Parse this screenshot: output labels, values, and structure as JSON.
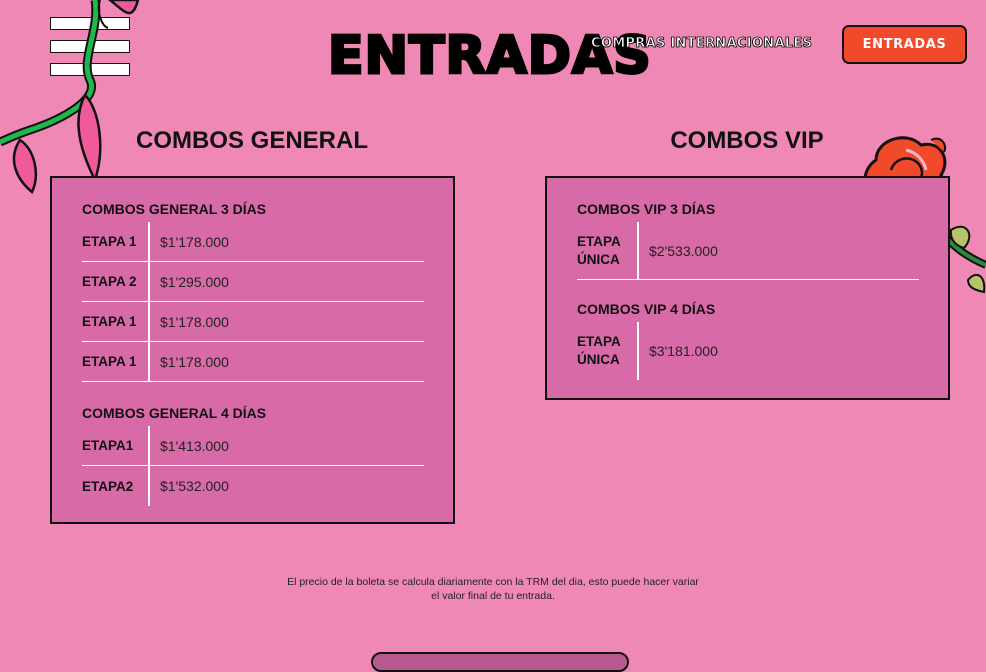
{
  "header": {
    "title": "ENTRADAS",
    "international_link": "COMPRAS INTERNACIONALES",
    "cta_button": "ENTRADAS"
  },
  "general": {
    "title": "COMBOS GENERAL",
    "groups": [
      {
        "label": "COMBOS GENERAL 3 DÍAS",
        "rows": [
          {
            "stage": "ETAPA 1",
            "price": "$1'178.000"
          },
          {
            "stage": "ETAPA 2",
            "price": "$1'295.000"
          },
          {
            "stage": "ETAPA 1",
            "price": "$1'178.000"
          },
          {
            "stage": "ETAPA 1",
            "price": "$1'178.000"
          }
        ]
      },
      {
        "label": "COMBOS GENERAL 4 DÍAS",
        "rows": [
          {
            "stage": "ETAPA1",
            "price": "$1'413.000"
          },
          {
            "stage": "ETAPA2",
            "price": "$1'532.000"
          }
        ]
      }
    ]
  },
  "vip": {
    "title": "COMBOS VIP",
    "groups": [
      {
        "label": "COMBOS VIP 3 DÍAS",
        "rows": [
          {
            "stage_line1": "ETAPA",
            "stage_line2": "ÚNICA",
            "price": "$2'533.000"
          }
        ]
      },
      {
        "label": "COMBOS VIP 4 DÍAS",
        "rows": [
          {
            "stage_line1": "ETAPA",
            "stage_line2": "ÚNICA",
            "price": "$3'181.000"
          }
        ]
      }
    ]
  },
  "footnote": {
    "line1": "El precio de la boleta se calcula diariamente con la TRM del dia, esto puede hacer variar",
    "line2": "el valor final de tu entrada."
  },
  "colors": {
    "background": "#f088b6",
    "card": "#d96aa8",
    "cta": "#f04a2a"
  },
  "icons": [
    "menu-icon",
    "vine-decoration",
    "rose-decoration"
  ]
}
